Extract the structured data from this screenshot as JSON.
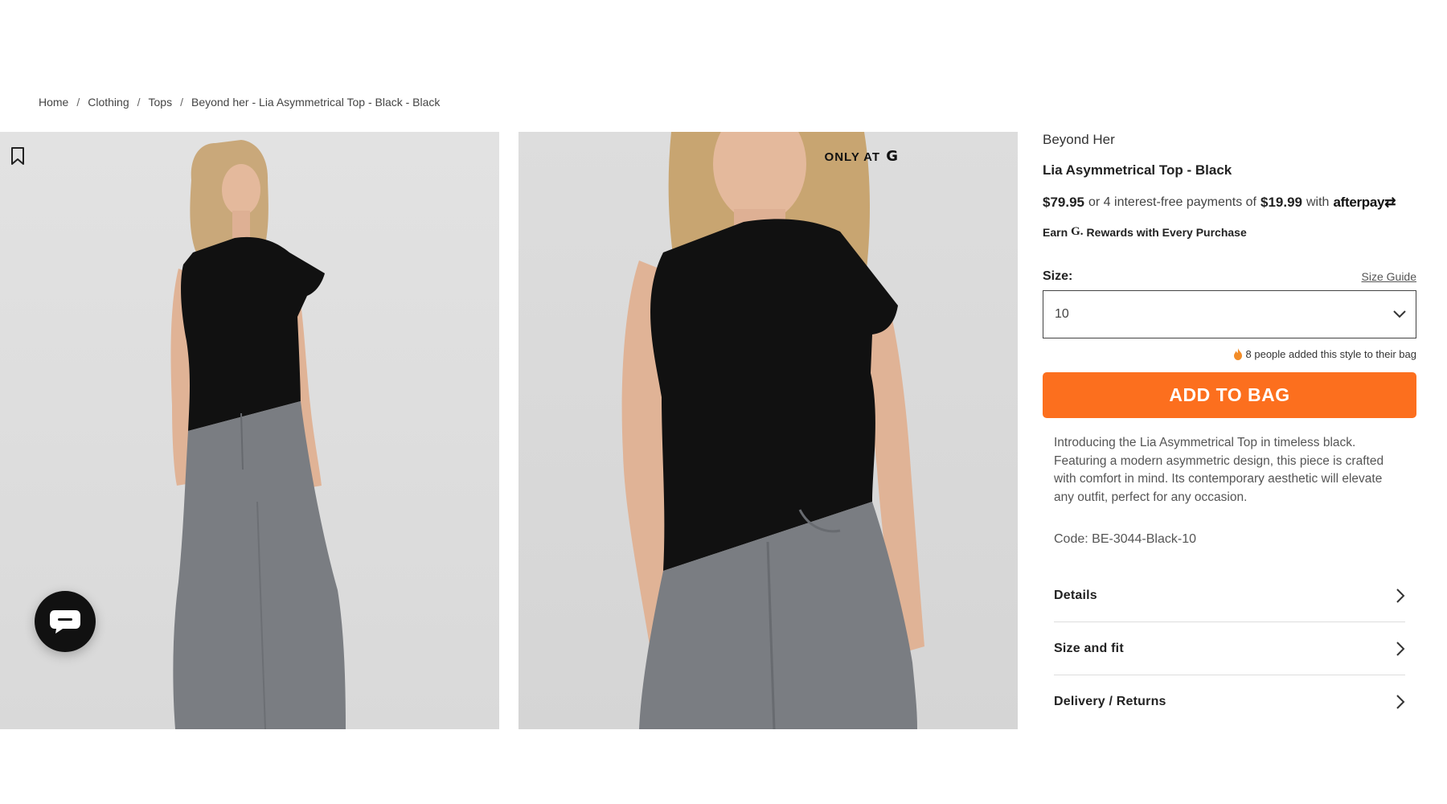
{
  "breadcrumb": {
    "home": "Home",
    "clothing": "Clothing",
    "tops": "Tops",
    "current": "Beyond her - Lia Asymmetrical Top - Black - Black",
    "sep1": "/",
    "sep2": "/",
    "sep3": "/"
  },
  "gallery": {
    "badge": "ONLY AT"
  },
  "product": {
    "brand": "Beyond Her",
    "title": "Lia Asymmetrical Top - Black",
    "price": "$79.95",
    "installment_text_1": "or 4 interest-free payments of",
    "installment_price": "$19.99",
    "installment_text_2": "with",
    "afterpay": "afterpay",
    "earn_prefix": "Earn",
    "earn_suffix": "Rewards with Every Purchase",
    "size_label": "Size:",
    "size_guide": "Size Guide",
    "size_value": "10",
    "social_proof": "8 people added this style to their bag",
    "add_to_bag": "ADD TO BAG",
    "description": "Introducing the Lia Asymmetrical Top in timeless black. Featuring a modern asymmetric design, this piece is crafted with comfort in mind. Its contemporary aesthetic will elevate any outfit, perfect for any occasion.",
    "code": "Code: BE-3044-Black-10"
  },
  "accordion": {
    "details": "Details",
    "size_fit": "Size and fit",
    "delivery": "Delivery / Returns"
  },
  "colors": {
    "accent": "#fc6f1e",
    "top": "#111111",
    "denim": "#7a7d82"
  }
}
